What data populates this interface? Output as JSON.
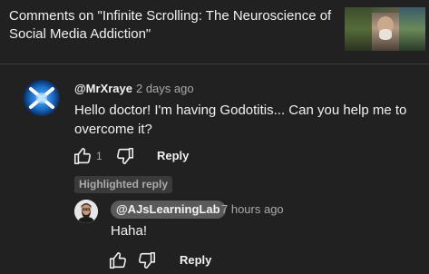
{
  "header": {
    "title": "Comments on \"Infinite Scrolling: The Neuroscience of Social Media Addiction\"",
    "thumbnail_icon": "video-thumbnail"
  },
  "comment": {
    "author": "@MrXraye",
    "timestamp": "2 days ago",
    "text": "Hello doctor! I'm having Godotitis... Can you help me to overcome it?",
    "like_count": "1",
    "reply_label": "Reply",
    "avatar_icon": "godot-logo-avatar"
  },
  "highlighted_label": "Highlighted reply",
  "reply": {
    "author": "@AJsLearningLab",
    "timestamp": "7 hours ago",
    "text": "Haha!",
    "reply_label": "Reply",
    "avatar_icon": "bearded-man-avatar"
  },
  "colors": {
    "background": "#212121",
    "text_primary": "#f1f1f1",
    "text_secondary": "#aaaaaa",
    "badge_bg": "#3a3a3a",
    "chip_bg": "#5a5a5a"
  }
}
